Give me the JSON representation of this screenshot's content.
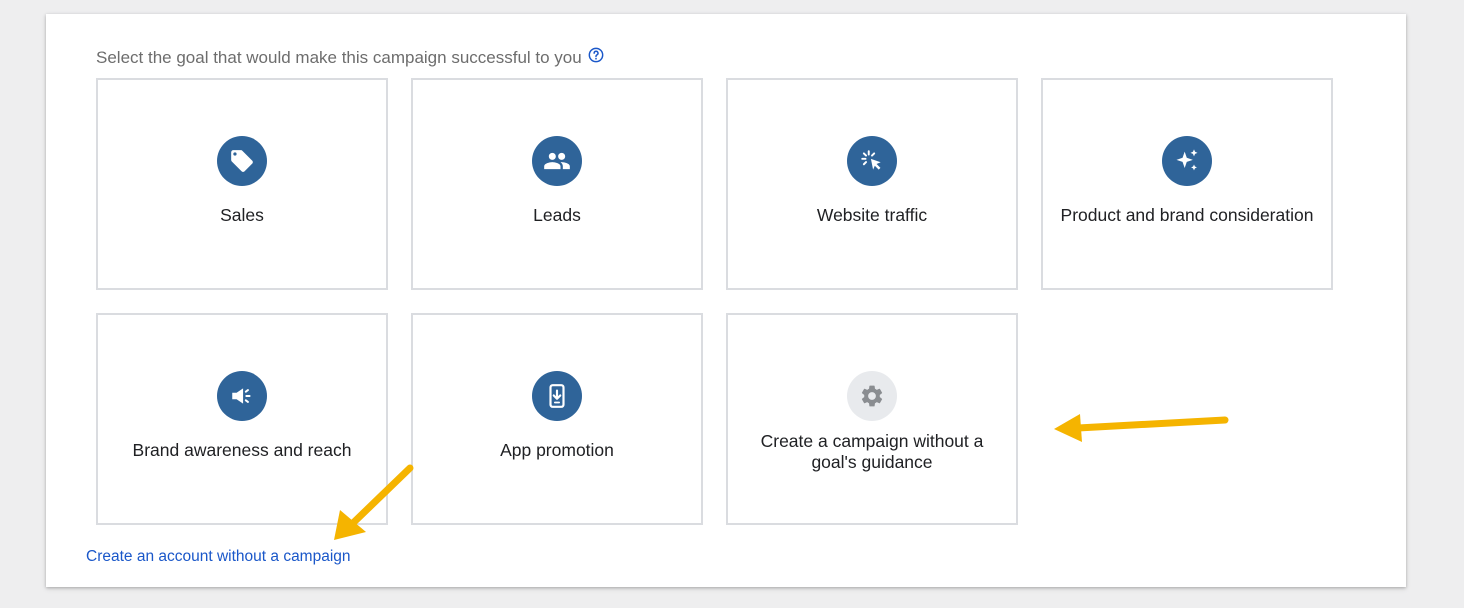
{
  "prompt": {
    "text": "Select the goal that would make this campaign successful to you",
    "help_icon": "help-circle-icon"
  },
  "goals": [
    {
      "label": "Sales",
      "icon": "tag-icon"
    },
    {
      "label": "Leads",
      "icon": "people-icon"
    },
    {
      "label": "Website traffic",
      "icon": "cursor-click-icon"
    },
    {
      "label": "Product and brand consideration",
      "icon": "sparkle-icon"
    },
    {
      "label": "Brand awareness and reach",
      "icon": "megaphone-icon"
    },
    {
      "label": "App promotion",
      "icon": "phone-download-icon"
    },
    {
      "label": "Create a campaign without a goal's guidance",
      "icon": "gear-icon"
    }
  ],
  "footer_link": "Create an account without a campaign",
  "colors": {
    "icon_circle": "#2f6499",
    "icon_circle_muted": "#e8eaed",
    "link": "#1a57c9",
    "annotation_arrow": "#f5b400"
  }
}
